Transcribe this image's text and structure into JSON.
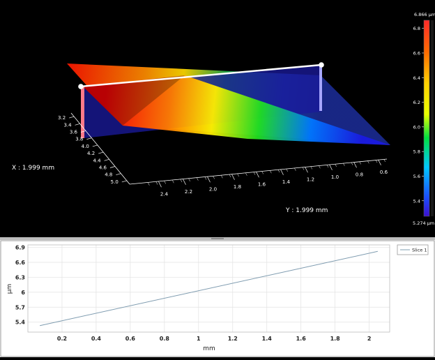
{
  "view3d": {
    "x_readout": "X : 1.999 mm",
    "y_readout": "Y : 1.999 mm",
    "x_axis_ticks": [
      "3.2",
      "3.4",
      "3.6",
      "3.8",
      "4.0",
      "4.2",
      "4.4",
      "4.6",
      "4.8",
      "5.0"
    ],
    "y_axis_ticks": [
      "2.4",
      "2.2",
      "2.0",
      "1.8",
      "1.6",
      "1.4",
      "1.2",
      "1.0",
      "0.8",
      "0.6"
    ],
    "colorbar": {
      "max_label": "6.866 µm",
      "min_label": "5.274 µm",
      "min": 5.274,
      "max": 6.866,
      "ticks": [
        "6.8",
        "6.6",
        "6.4",
        "6.2",
        "6.0",
        "5.8",
        "5.6",
        "5.4"
      ]
    }
  },
  "chart_data": {
    "type": "line",
    "xlabel": "mm",
    "ylabel": "µm",
    "xlim": [
      0,
      2.12
    ],
    "ylim": [
      5.2,
      6.95
    ],
    "x_ticks": [
      "0.2",
      "0.4",
      "0.6",
      "0.8",
      "1",
      "1.2",
      "1.4",
      "1.6",
      "1.8",
      "2"
    ],
    "y_ticks": [
      "6.9",
      "6.6",
      "6.3",
      "6",
      "5.7",
      "5.4"
    ],
    "grid": true,
    "legend_position": "top-right",
    "series": [
      {
        "name": "Slice 1",
        "color": "#7f9cb0",
        "x": [
          0.07,
          2.05
        ],
        "y": [
          5.33,
          6.82
        ]
      }
    ]
  }
}
